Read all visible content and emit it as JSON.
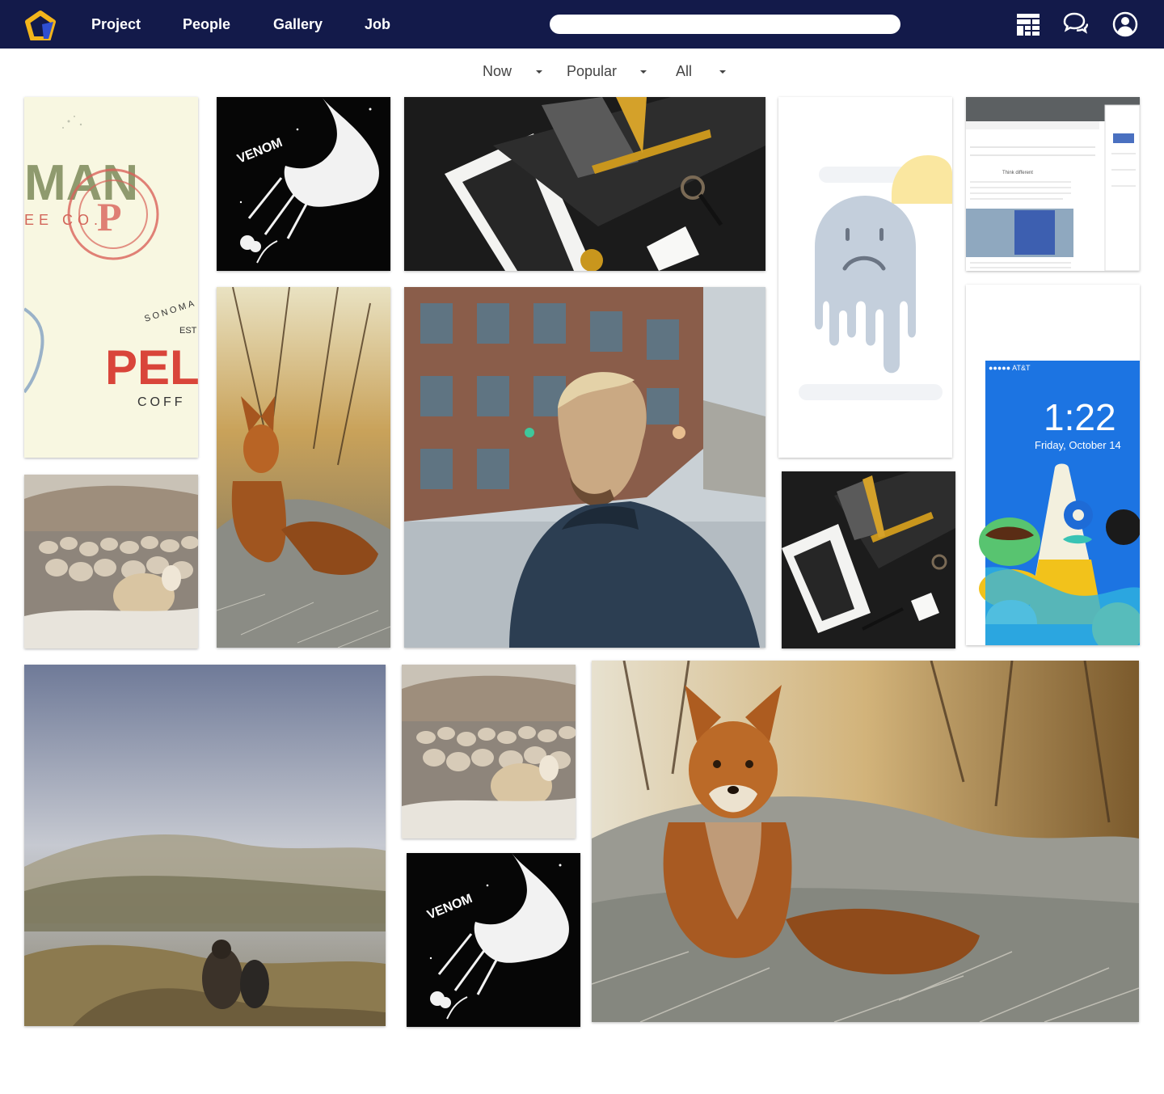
{
  "header": {
    "nav": [
      {
        "label": "Project"
      },
      {
        "label": "People"
      },
      {
        "label": "Gallery"
      },
      {
        "label": "Job"
      }
    ],
    "search": {
      "value": "",
      "placeholder": ""
    },
    "icons": [
      "layout-icon",
      "chat-icon",
      "user-avatar-icon"
    ]
  },
  "filters": [
    {
      "label": "Now"
    },
    {
      "label": "Popular"
    },
    {
      "label": "All"
    }
  ],
  "colors": {
    "header_bg": "#131a4a",
    "logo_gold": "#f3b51b",
    "logo_blue": "#2f4fd1"
  },
  "tiles": {
    "coffee_brand": {
      "texts": {
        "a": "MAN",
        "b": "EE CO.",
        "c": "SONOMA",
        "d": "EST",
        "e": "PEL",
        "f": "COFF"
      }
    },
    "venom_art_1": {
      "text": "VENOM"
    },
    "venom_art_2": {
      "text": "VENOM"
    },
    "website_mockup": {
      "text": "Think different"
    },
    "phone_lockscreen": {
      "carrier": "●●●●● AT&T",
      "time": "1:22",
      "date": "Friday, October 14"
    }
  }
}
